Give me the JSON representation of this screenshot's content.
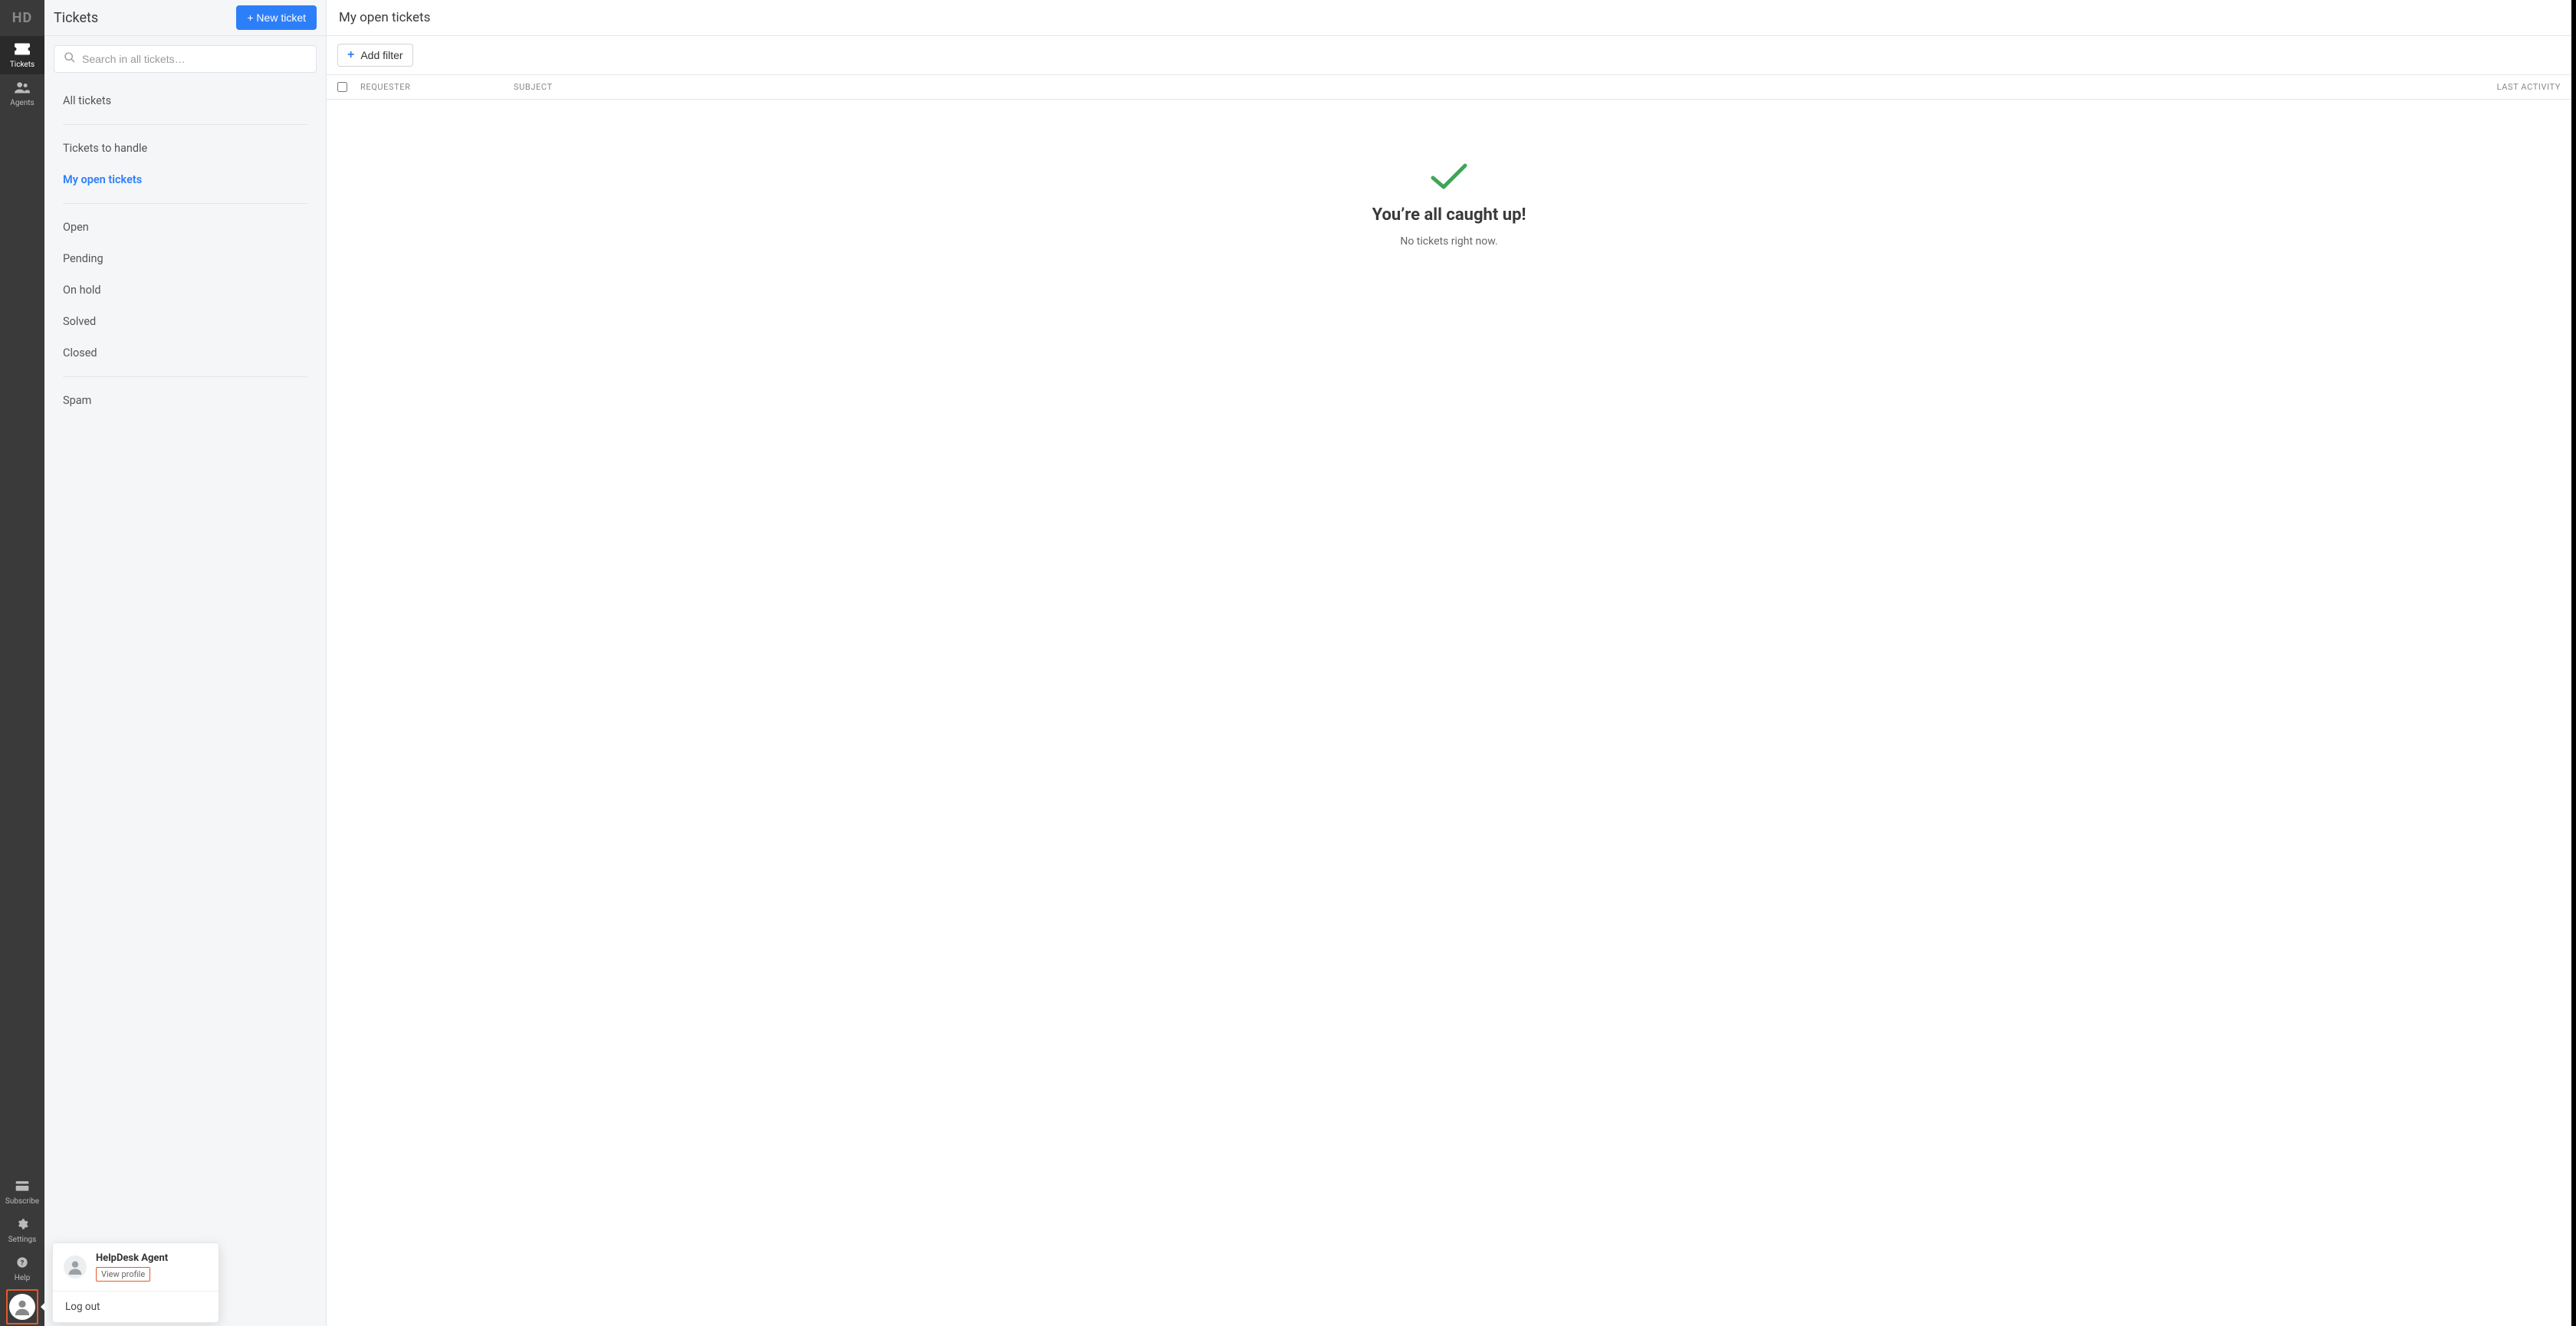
{
  "rail": {
    "logo": "HD",
    "items": [
      {
        "key": "tickets",
        "label": "Tickets"
      },
      {
        "key": "agents",
        "label": "Agents"
      }
    ],
    "bottom": [
      {
        "key": "subscribe",
        "label": "Subscribe"
      },
      {
        "key": "settings",
        "label": "Settings"
      },
      {
        "key": "help",
        "label": "Help"
      }
    ]
  },
  "side": {
    "title": "Tickets",
    "new_ticket_label": "+ New ticket",
    "search_placeholder": "Search in all tickets…",
    "groups": [
      {
        "items": [
          {
            "key": "all",
            "label": "All tickets"
          }
        ]
      },
      {
        "items": [
          {
            "key": "to_handle",
            "label": "Tickets to handle"
          },
          {
            "key": "my_open",
            "label": "My open tickets",
            "selected": true
          }
        ]
      },
      {
        "items": [
          {
            "key": "open",
            "label": "Open"
          },
          {
            "key": "pending",
            "label": "Pending"
          },
          {
            "key": "onhold",
            "label": "On hold"
          },
          {
            "key": "solved",
            "label": "Solved"
          },
          {
            "key": "closed",
            "label": "Closed"
          }
        ]
      },
      {
        "items": [
          {
            "key": "spam",
            "label": "Spam"
          }
        ]
      }
    ]
  },
  "popover": {
    "user_name": "HelpDesk Agent",
    "view_profile": "View profile",
    "logout": "Log out"
  },
  "main": {
    "title": "My open tickets",
    "add_filter": "Add filter",
    "columns": {
      "requester": "Requester",
      "subject": "Subject",
      "last_activity": "Last activity"
    },
    "empty": {
      "title": "You’re all caught up!",
      "subtitle": "No tickets right now."
    }
  }
}
